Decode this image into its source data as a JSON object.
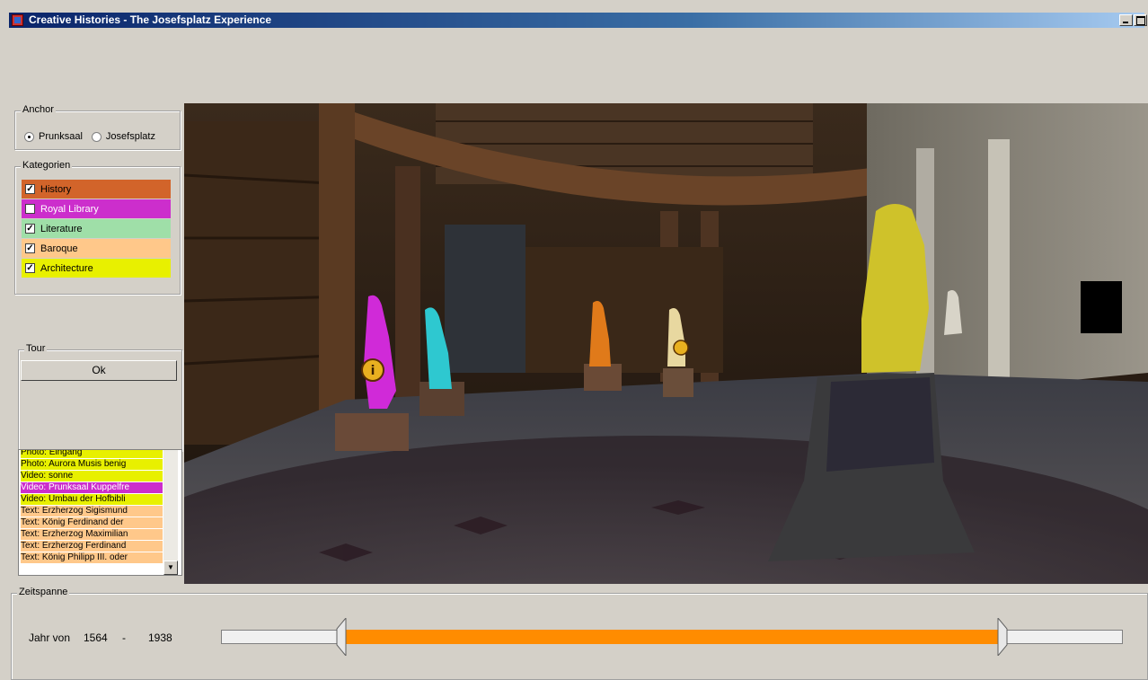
{
  "window": {
    "title": "Creative Histories - The Josefsplatz Experience"
  },
  "anchor": {
    "legend": "Anchor",
    "options": [
      {
        "label": "Prunksaal",
        "selected": true
      },
      {
        "label": "Josefsplatz",
        "selected": false
      }
    ]
  },
  "kategorien": {
    "legend": "Kategorien",
    "items": [
      {
        "label": "History",
        "checked": true,
        "color": "#d2642a"
      },
      {
        "label": "Royal Library",
        "checked": false,
        "color": "#cc2ecc"
      },
      {
        "label": "Literature",
        "checked": true,
        "color": "#9fdfa8"
      },
      {
        "label": "Baroque",
        "checked": true,
        "color": "#ffc88a"
      },
      {
        "label": "Architecture",
        "checked": true,
        "color": "#e8f000"
      }
    ]
  },
  "tour": {
    "legend": "Tour",
    "button_label": "Ok"
  },
  "media_list": {
    "items": [
      {
        "label": "Photo: Eingang",
        "color": "#e8f000"
      },
      {
        "label": "Photo:  Aurora  Musis  benig",
        "color": "#e8f000"
      },
      {
        "label": "Video: sonne",
        "color": "#e8f000"
      },
      {
        "label": "Video:  Prunksaal Kuppelfre",
        "color": "#cc2ecc"
      },
      {
        "label": "Video:  Umbau  der Hofbibli",
        "color": "#e8f000"
      },
      {
        "label": "Text: Erzherzog Sigismund",
        "color": "#ffc88a"
      },
      {
        "label": "Text:  König Ferdinand der",
        "color": "#ffc88a"
      },
      {
        "label": "Text: Erzherzog Maximilian",
        "color": "#ffc88a"
      },
      {
        "label": "Text: Erzherzog Ferdinand",
        "color": "#ffc88a"
      },
      {
        "label": "Text: König Philipp III. oder",
        "color": "#ffc88a"
      }
    ]
  },
  "zeitspanne": {
    "legend": "Zeitspanne",
    "label": "Jahr von",
    "from": "1564",
    "separator": "-",
    "to": "1938",
    "range_start_fraction": 0.138,
    "range_end_fraction": 0.862,
    "fill_color": "#ff8c00"
  }
}
